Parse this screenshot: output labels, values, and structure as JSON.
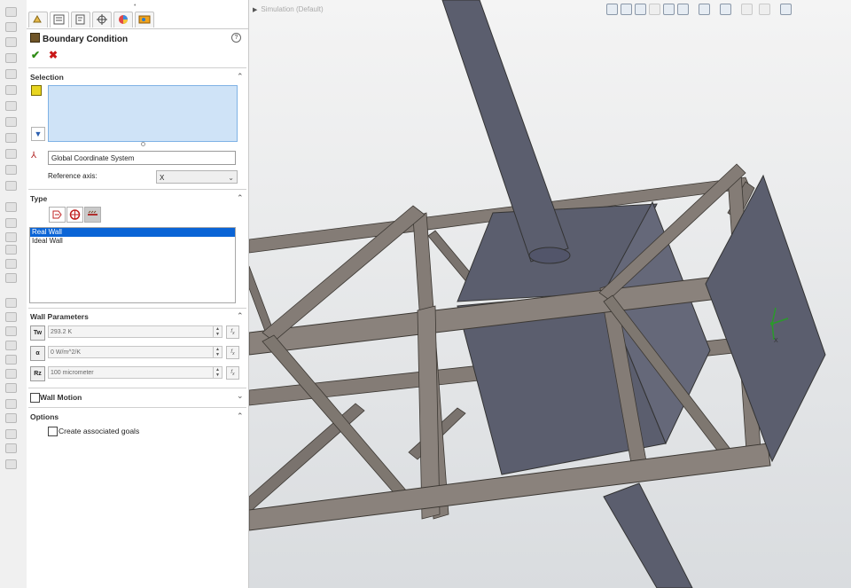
{
  "panel": {
    "title": "Boundary Condition",
    "help": "?",
    "ok": "✔",
    "cancel": "✖"
  },
  "selection": {
    "header": "Selection",
    "coordinate_system": "Global Coordinate System",
    "reference_axis_label": "Reference axis:",
    "reference_axis_value": "X"
  },
  "type": {
    "header": "Type",
    "items": [
      "Real Wall",
      "Ideal Wall"
    ],
    "selected_index": 0
  },
  "wall_parameters": {
    "header": "Wall Parameters",
    "temperature": "293.2 K",
    "heat_transfer": "0 W/m^2/K",
    "roughness": "100 micrometer",
    "icon_labels": [
      "Tw",
      "α",
      "Rz"
    ]
  },
  "wall_motion": {
    "label": "Wall Motion",
    "checked": false
  },
  "options": {
    "header": "Options",
    "create_goals_label": "Create associated goals",
    "create_goals_checked": false
  },
  "viewport": {
    "breadcrumb": "Simulation (Default)",
    "triad_x": "X"
  },
  "colors": {
    "selection_box": "#cfe3f7",
    "selected_item": "#0a64d6",
    "steel": "#847c76",
    "steel_dark": "#5c5651",
    "plate": "#5b5e6e",
    "background": "#e4e6e8",
    "ok": "#2f8c16",
    "cancel": "#c91818"
  },
  "icons": {
    "tabs": [
      "feature-manager-icon",
      "property-manager-icon",
      "configuration-manager-icon",
      "dimxpert-icon",
      "display-manager-icon",
      "flow-analysis-icon"
    ],
    "type_buttons": [
      "inlet-outlet-icon",
      "pressure-opening-icon",
      "wall-icon"
    ]
  }
}
